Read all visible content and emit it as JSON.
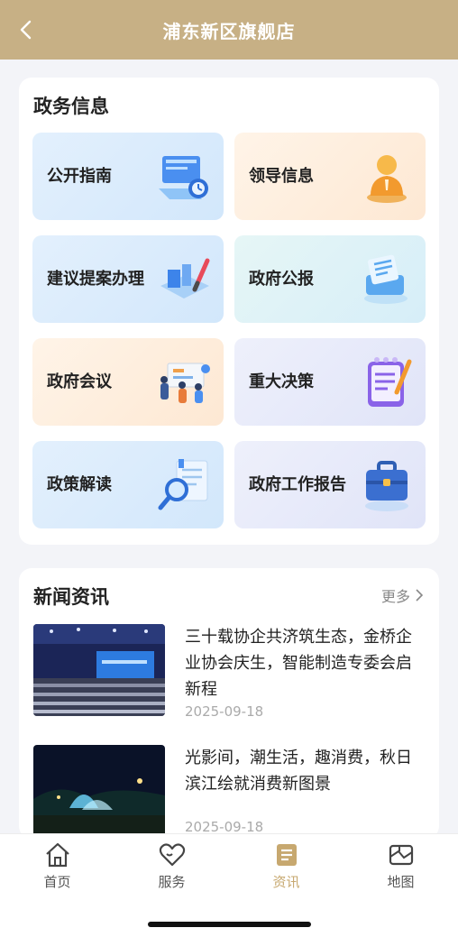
{
  "header": {
    "title": "浦东新区旗舰店",
    "back_icon": "chevron-left-icon"
  },
  "gov": {
    "title": "政务信息",
    "tiles": [
      {
        "label": "公开指南",
        "icon": "guide-icon"
      },
      {
        "label": "领导信息",
        "icon": "leader-icon"
      },
      {
        "label": "建议提案办理",
        "icon": "proposal-icon"
      },
      {
        "label": "政府公报",
        "icon": "bulletin-icon"
      },
      {
        "label": "政府会议",
        "icon": "meeting-icon"
      },
      {
        "label": "重大决策",
        "icon": "decision-icon"
      },
      {
        "label": "政策解读",
        "icon": "magnifier-icon"
      },
      {
        "label": "政府工作报告",
        "icon": "briefcase-icon"
      }
    ]
  },
  "news": {
    "title": "新闻资讯",
    "more": "更多",
    "items": [
      {
        "title": "三十载协企共济筑生态，金桥企业协会庆生，智能制造专委会启新程",
        "date": "2025-09-18"
      },
      {
        "title": "光影间，潮生活，趣消费，秋日滨江绘就消费新图景",
        "date": "2025-09-18"
      }
    ]
  },
  "tabs": [
    {
      "label": "首页",
      "icon": "home-icon",
      "active": false
    },
    {
      "label": "服务",
      "icon": "heart-icon",
      "active": false
    },
    {
      "label": "资讯",
      "icon": "news-icon",
      "active": true
    },
    {
      "label": "地图",
      "icon": "map-icon",
      "active": false
    }
  ],
  "colors": {
    "header": "#c7b085",
    "active_tab": "#c7a86f"
  }
}
